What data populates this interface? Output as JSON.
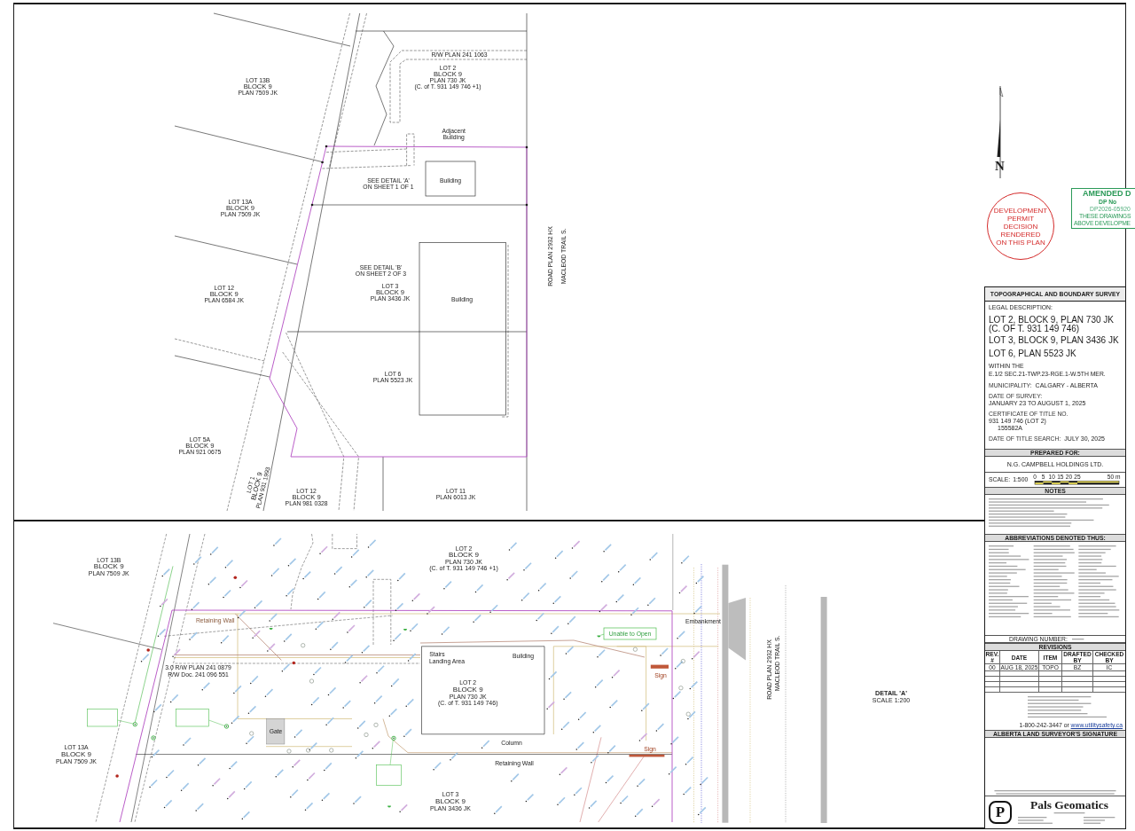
{
  "site_plan": {
    "parcels": [
      {
        "lines": [
          "LOT 13B",
          "BLOCK 9",
          "PLAN 7509 JK"
        ]
      },
      {
        "lines": [
          "LOT 2",
          "BLOCK 9",
          "PLAN 730 JK",
          "(C. of T. 931 149 746 +1)"
        ]
      },
      {
        "lines": [
          "LOT 13A",
          "BLOCK 9",
          "PLAN 7509 JK"
        ]
      },
      {
        "lines": [
          "LOT 12",
          "BLOCK 9",
          "PLAN 6584 JK"
        ]
      },
      {
        "lines": [
          "LOT 3",
          "BLOCK 9",
          "PLAN 3436 JK"
        ]
      },
      {
        "lines": [
          "LOT 6",
          "PLAN 5523 JK"
        ]
      },
      {
        "lines": [
          "LOT 5A",
          "BLOCK 9",
          "PLAN 921 0675"
        ]
      },
      {
        "lines": [
          "LOT 1",
          "BLOCK 9",
          "PLAN 931 1993"
        ]
      },
      {
        "lines": [
          "LOT 12",
          "BLOCK 9",
          "PLAN 981 0328"
        ]
      },
      {
        "lines": [
          "LOT 11",
          "PLAN 6013 JK"
        ]
      }
    ],
    "detail_references": [
      {
        "lines": [
          "SEE DETAIL 'A'",
          "ON SHEET 1 OF 1"
        ]
      },
      {
        "lines": [
          "SEE DETAIL 'B'",
          "ON SHEET 2 OF 3"
        ]
      }
    ],
    "buildings": [
      "Building",
      "Building"
    ],
    "adjacent_building": [
      "Adjacent",
      "Building"
    ],
    "right_of_way_label": "R/W PLAN 241 1063",
    "road_labels": [
      "ROAD PLAN 2932 HX",
      "MACLEOD TRAIL S."
    ]
  },
  "detail_a": {
    "parcels": [
      {
        "lines": [
          "LOT 13B",
          "BLOCK 9",
          "PLAN 7509 JK"
        ]
      },
      {
        "lines": [
          "LOT 2",
          "BLOCK 9",
          "PLAN 730 JK",
          "(C. of T. 931 149 746 +1)"
        ]
      },
      {
        "lines": [
          "LOT 2",
          "BLOCK 9",
          "PLAN 730 JK",
          "(C. of T. 931 149 746)"
        ]
      },
      {
        "lines": [
          "LOT 13A",
          "BLOCK 9",
          "PLAN 7509 JK"
        ]
      },
      {
        "lines": [
          "LOT 3",
          "BLOCK 9",
          "PLAN 3436 JK"
        ]
      }
    ],
    "right_of_way_label": [
      "3.0 R/W PLAN 241 0879",
      "R/W Doc. 241 096 551"
    ],
    "features": [
      "Retaining Wall",
      "Stairs",
      "Landing Area",
      "Building",
      "Unable to Open",
      "Column",
      "Retaining Wall",
      "Sign",
      "Sign",
      "Embankment",
      "Gate"
    ],
    "road_labels": [
      "ROAD PLAN 2932 HX",
      "MACLEOD TRAIL S."
    ],
    "title": "DETAIL 'A'",
    "scale": "SCALE 1:200"
  },
  "north_arrow": {
    "label": "N"
  },
  "permit_stamp": {
    "lines": [
      "DEVELOPMENT",
      "PERMIT",
      "DECISION",
      "RENDERED",
      "ON THIS PLAN"
    ]
  },
  "amended_stamp": {
    "lines": [
      "AMENDED D",
      "DP No",
      "DP2026-05920",
      "THESE DRAWINGS",
      "ABOVE DEVELOPME"
    ]
  },
  "title_block": {
    "title": "TOPOGRAPHICAL AND BOUNDARY SURVEY",
    "legal_heading": "LEGAL DESCRIPTION:",
    "legal_parcels": [
      [
        "LOT 2, BLOCK 9, PLAN 730 JK",
        "(C. OF T. 931 149 746)"
      ],
      [
        "LOT 3, BLOCK 9, PLAN 3436 JK"
      ],
      [
        "LOT 6, PLAN 5523 JK"
      ]
    ],
    "within": "WITHIN THE",
    "meridian": "E.1/2 SEC.21-TWP.23-RGE.1-W.5TH MER.",
    "fields": [
      {
        "label": "MUNICIPALITY:",
        "value": "CALGARY - ALBERTA"
      },
      {
        "label": "DATE OF SURVEY:",
        "value": "JANUARY 23 TO AUGUST 1, 2025"
      },
      {
        "label": "CERTIFICATE OF TITLE NO.",
        "value": "931 149 746 (LOT 2)",
        "subvalue": "155582A"
      },
      {
        "label": "DATE OF TITLE SEARCH:",
        "value": "JULY 30, 2025"
      }
    ],
    "prepared_for_heading": "PREPARED FOR:",
    "client": "N.G. CAMPBELL HOLDINGS LTD.",
    "scale": {
      "label": "SCALE:",
      "value": "1:500",
      "ticks": [
        "0",
        "5",
        "10",
        "15",
        "20",
        "25",
        "50 m"
      ]
    },
    "notes_heading": "NOTES",
    "abbreviations_heading": "ABBREVIATIONS DENOTED THUS:",
    "drawing_number_label": "DRAWING NUMBER:",
    "revisions_heading": "REVISIONS",
    "revision_columns": [
      "REV. #",
      "DATE",
      "ITEM",
      "DRAFTED BY",
      "CHECKED BY"
    ],
    "revisions": [
      [
        "00",
        "AUG 18, 2025",
        "TOPO",
        "BZ",
        "IC"
      ]
    ],
    "utility_contact": {
      "phone": "1-800-242-3447",
      "joiner": "or",
      "link": "www.utilitysafety.ca"
    },
    "signature_heading": "ALBERTA LAND SURVEYOR'S SIGNATURE",
    "company": {
      "logo_letter": "P",
      "name": "Pals Geomatics"
    }
  }
}
